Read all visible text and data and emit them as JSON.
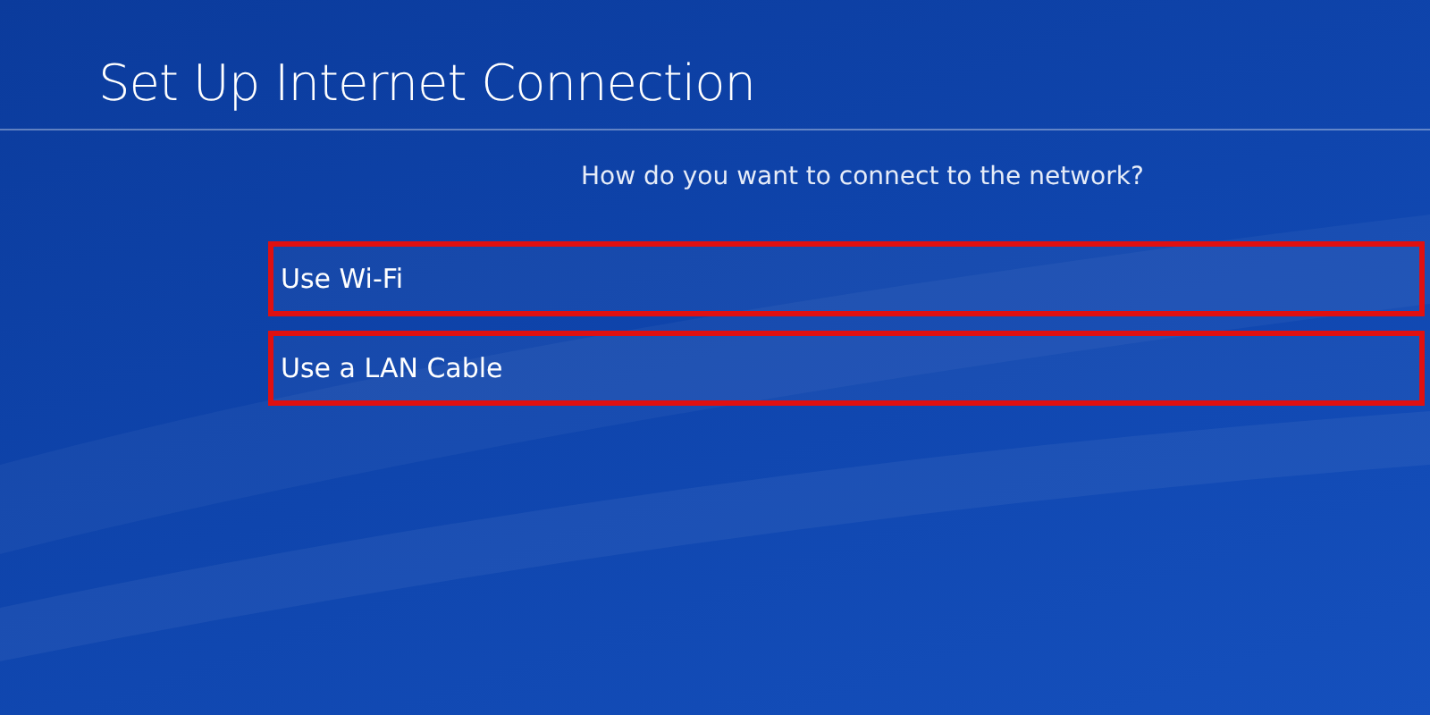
{
  "screen": {
    "title": "Set Up Internet Connection",
    "question": "How do you want to connect to the network?"
  },
  "options": [
    {
      "label": "Use Wi-Fi",
      "highlighted": true
    },
    {
      "label": "Use a LAN Cable",
      "highlighted": true
    }
  ]
}
